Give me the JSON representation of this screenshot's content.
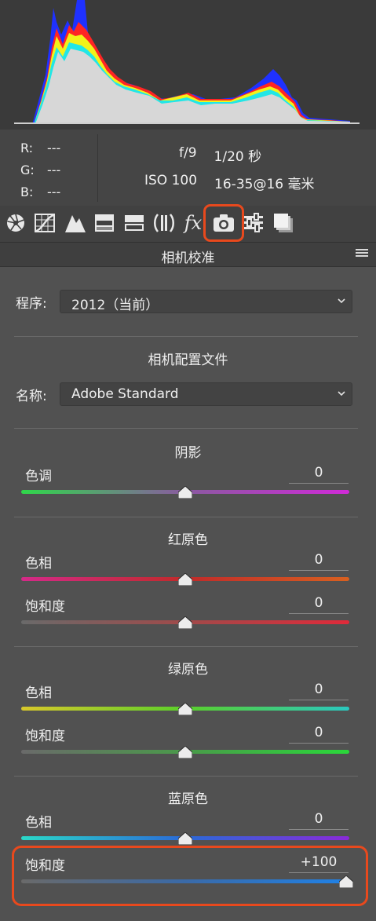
{
  "info": {
    "rgb": [
      {
        "channel": "R:",
        "value": "---"
      },
      {
        "channel": "G:",
        "value": "---"
      },
      {
        "channel": "B:",
        "value": "---"
      }
    ],
    "aperture": "f/9",
    "shutter": "1/20 秒",
    "iso": "ISO 100",
    "lens": "16-35@16 毫米"
  },
  "toolbar": {
    "icons": [
      "basic-aperture-icon",
      "tone-curve-icon",
      "detail-icon",
      "hsl-icon",
      "split-toning-icon",
      "lens-corrections-icon",
      "effects-icon",
      "camera-calibration-icon",
      "presets-icon",
      "snapshots-icon"
    ],
    "fx_label": "fx"
  },
  "panel": {
    "title": "相机校准",
    "process_label": "程序:",
    "process_value": "2012（当前）",
    "profile_heading": "相机配置文件",
    "name_label": "名称:",
    "name_value": "Adobe Standard"
  },
  "sections": [
    {
      "title": "阴影",
      "sliders": [
        {
          "label": "色调",
          "value": "0",
          "position": 0.5
        }
      ]
    },
    {
      "title": "红原色",
      "sliders": [
        {
          "label": "色相",
          "value": "0",
          "position": 0.5
        },
        {
          "label": "饱和度",
          "value": "0",
          "position": 0.5
        }
      ]
    },
    {
      "title": "绿原色",
      "sliders": [
        {
          "label": "色相",
          "value": "0",
          "position": 0.5
        },
        {
          "label": "饱和度",
          "value": "0",
          "position": 0.5
        }
      ]
    },
    {
      "title": "蓝原色",
      "sliders": [
        {
          "label": "色相",
          "value": "0",
          "position": 0.5
        },
        {
          "label": "饱和度",
          "value": "+100",
          "position": 1.0
        }
      ]
    }
  ],
  "colors": {
    "accent_highlight": "#e8491d",
    "panel_bg": "#515151"
  }
}
